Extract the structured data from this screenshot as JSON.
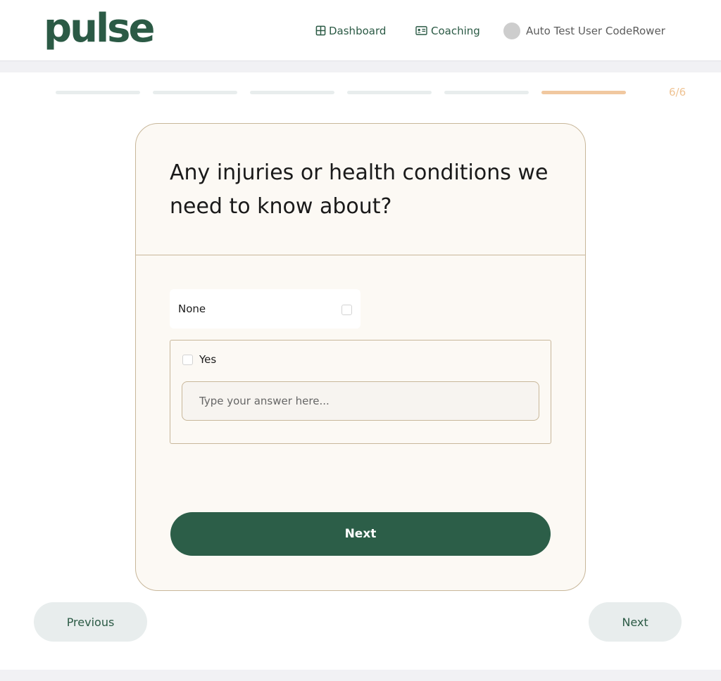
{
  "header": {
    "logo": "pulse",
    "nav": {
      "dashboard": "Dashboard",
      "coaching": "Coaching"
    },
    "user_name": "Auto Test User CodeRower"
  },
  "progress": {
    "current": 6,
    "total": 6,
    "label": "6/6",
    "segments": [
      false,
      false,
      false,
      false,
      false,
      true
    ]
  },
  "question": {
    "title": "Any injuries or health conditions we need to know about?",
    "options": {
      "none_label": "None",
      "yes_label": "Yes"
    },
    "answer_placeholder": "Type your answer here...",
    "answer_value": "",
    "submit_label": "Next"
  },
  "footer_nav": {
    "previous_label": "Previous",
    "next_label": "Next"
  },
  "colors": {
    "brand_green": "#2c5e48",
    "accent_orange": "#efc393",
    "card_border": "#c8b79a",
    "card_bg": "#fcf9f4"
  },
  "icons": {
    "dashboard": "grid-icon",
    "coaching": "id-card-icon"
  }
}
